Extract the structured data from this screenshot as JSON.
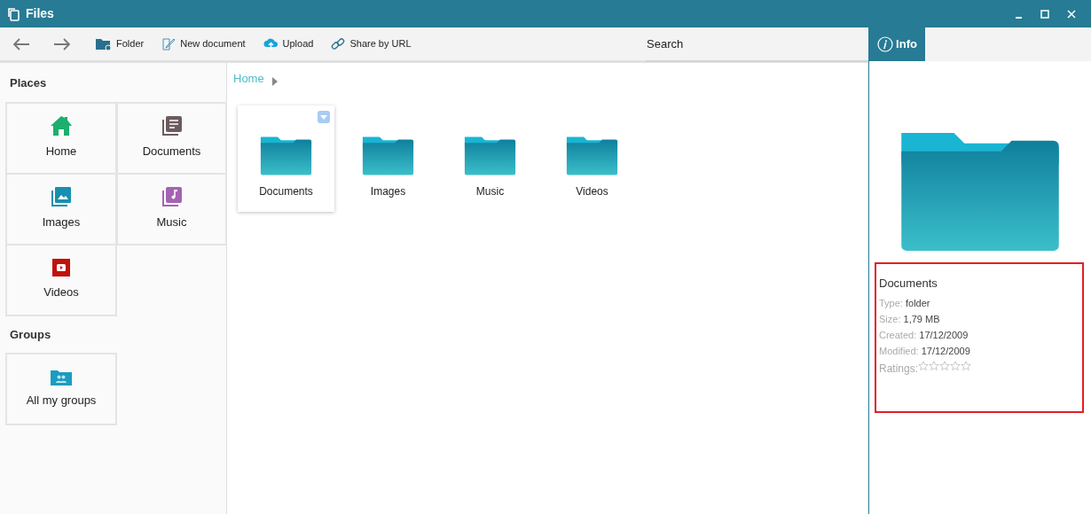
{
  "window": {
    "title": "Files"
  },
  "toolbar": {
    "buttons": [
      {
        "kind": "folder",
        "label": "Folder"
      },
      {
        "kind": "document",
        "label": "New document"
      },
      {
        "kind": "upload",
        "label": "Upload"
      },
      {
        "kind": "link",
        "label": "Share by URL"
      }
    ],
    "search": {
      "placeholder": "Search"
    }
  },
  "sidebar": {
    "sections": [
      {
        "title": "Places",
        "items": [
          {
            "kind": "home",
            "label": "Home"
          },
          {
            "kind": "documents",
            "label": "Documents"
          },
          {
            "kind": "images",
            "label": "Images"
          },
          {
            "kind": "music",
            "label": "Music"
          },
          {
            "kind": "videos",
            "label": "Videos"
          }
        ]
      },
      {
        "title": "Groups",
        "items": [
          {
            "kind": "groups",
            "label": "All my groups"
          }
        ]
      }
    ]
  },
  "breadcrumb": [
    "Home"
  ],
  "folders": [
    {
      "name": "Documents",
      "selected": true
    },
    {
      "name": "Images",
      "selected": false
    },
    {
      "name": "Music",
      "selected": false
    },
    {
      "name": "Videos",
      "selected": false
    }
  ],
  "info_panel": {
    "tab": "Info",
    "name": "Documents",
    "fields": [
      {
        "label": "Type:",
        "value": "folder"
      },
      {
        "label": "Size:",
        "value": "1,79 MB"
      },
      {
        "label": "Created:",
        "value": "17/12/2009"
      },
      {
        "label": "Modified:",
        "value": "17/12/2009"
      }
    ],
    "ratings_label": "Ratings:",
    "stars": 0
  }
}
